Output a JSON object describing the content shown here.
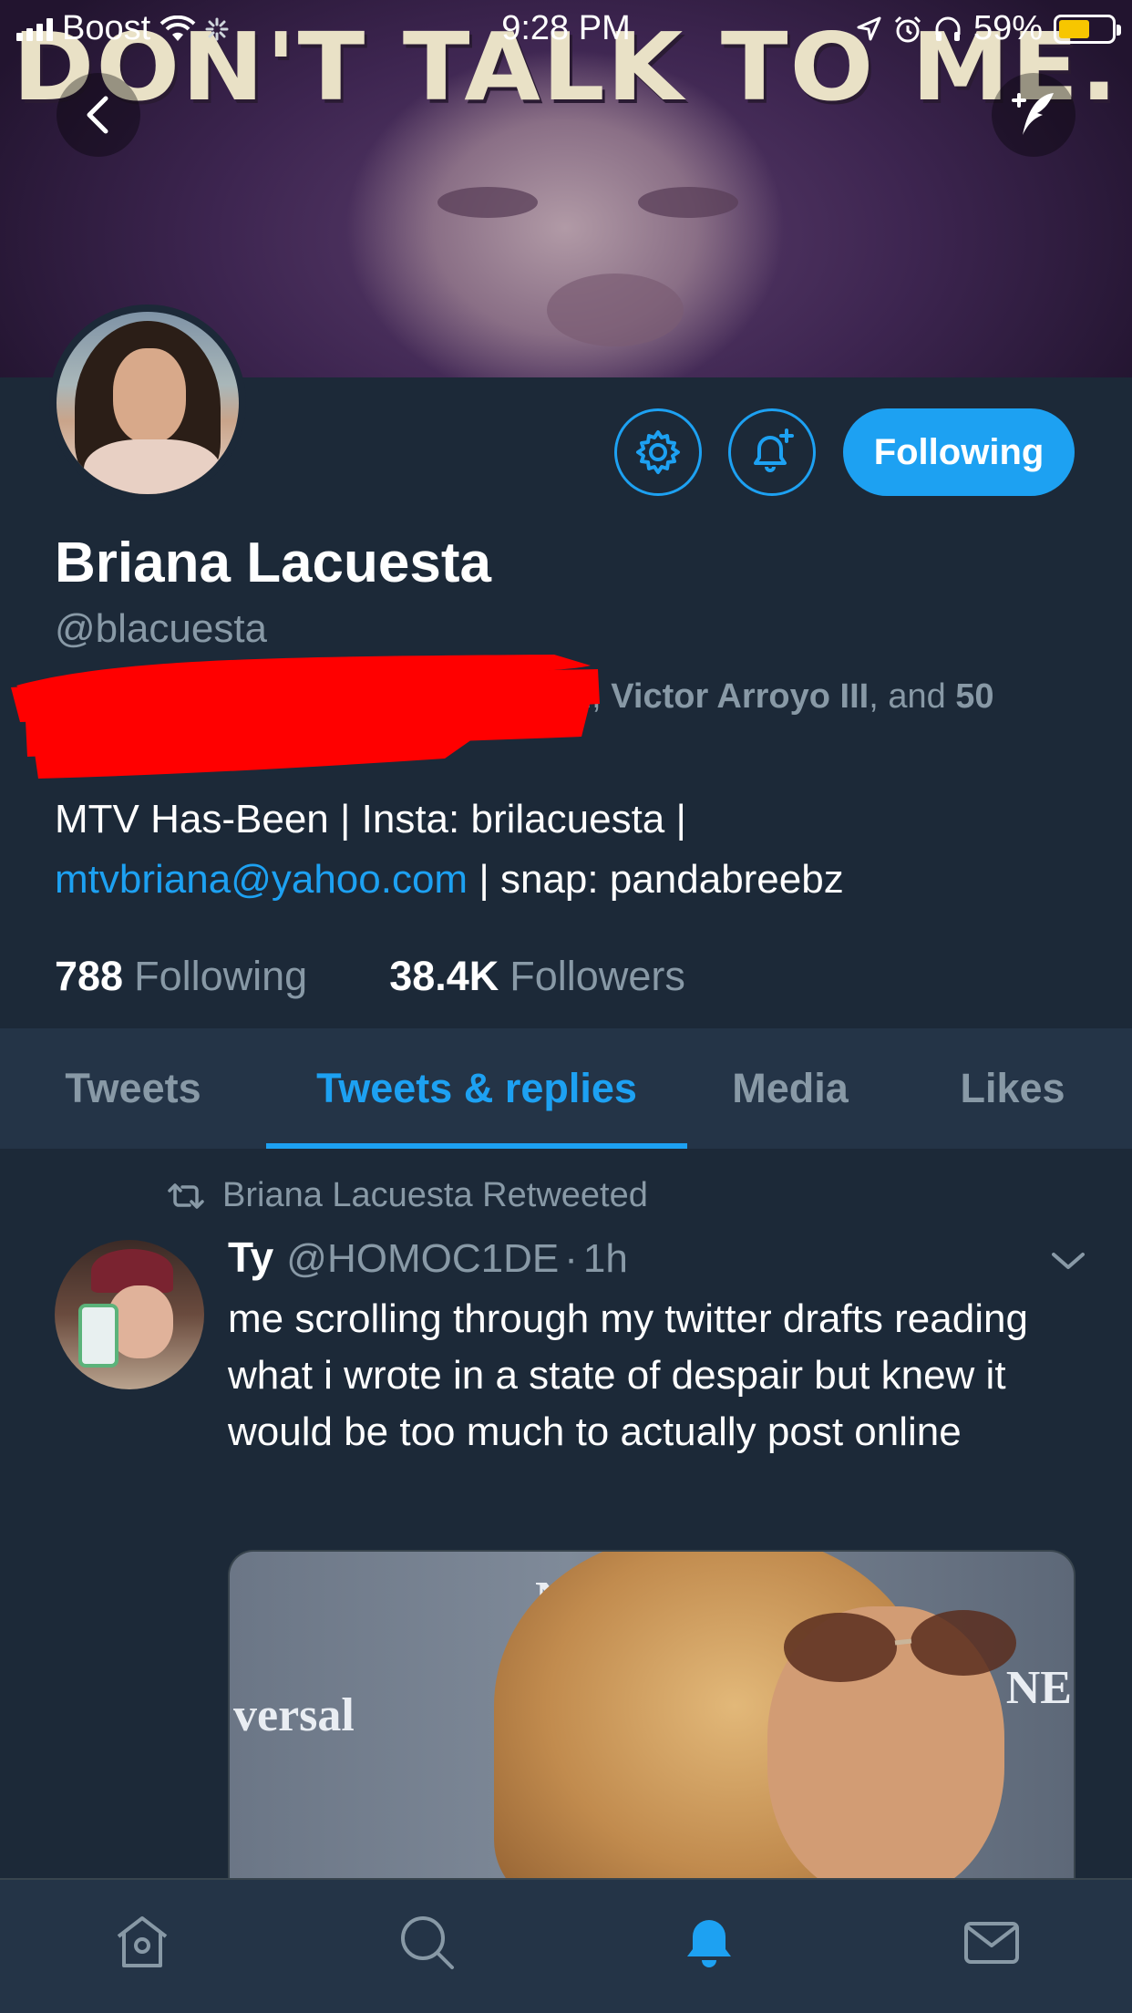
{
  "status_bar": {
    "carrier": "Boost",
    "time": "9:28 PM",
    "battery_percent": "59%",
    "battery_level": 0.59
  },
  "banner": {
    "image_text": "DON'T TALK TO ME."
  },
  "profile": {
    "display_name": "Briana Lacuesta",
    "handle": "@blacuesta",
    "following_button": "Following",
    "followed_by": {
      "prefix": "n, ",
      "name": "Victor Arroyo III",
      "middle": ", and ",
      "count": "50"
    },
    "bio": {
      "line1": "MTV Has-Been | Insta: brilacuesta |",
      "email": "mtvbriana@yahoo.com",
      "line2_rest": " | snap: pandabreebz"
    },
    "stats": {
      "following_count": "788",
      "following_label": "Following",
      "followers_count": "38.4K",
      "followers_label": "Followers"
    }
  },
  "tabs": [
    "Tweets",
    "Tweets & replies",
    "Media",
    "Likes"
  ],
  "tweet": {
    "retweeted_by": "Briana Lacuesta Retweeted",
    "author_name": "Ty",
    "author_handle": "@HOMOC1DE",
    "separator": "·",
    "time_ago": "1h",
    "text": "me scrolling through my twitter drafts reading what i wrote in a state of despair but knew it would be too much to actually post online",
    "media_text_left": "versal",
    "media_text_right": "NE",
    "media_text_top": "N"
  },
  "colors": {
    "accent": "#1da1f2",
    "background": "#1c2938",
    "secondary_text": "#8899a6",
    "bar_background": "#243447",
    "battery": "#f7c600"
  },
  "icons": {
    "back": "chevron-left-icon",
    "compose": "compose-quill-icon",
    "settings": "gear-icon",
    "notifications": "bell-plus-icon",
    "retweet": "retweet-icon",
    "more": "chevron-down-icon",
    "home": "home-icon",
    "search": "search-icon",
    "notifications_tab": "bell-icon",
    "messages": "envelope-icon"
  }
}
